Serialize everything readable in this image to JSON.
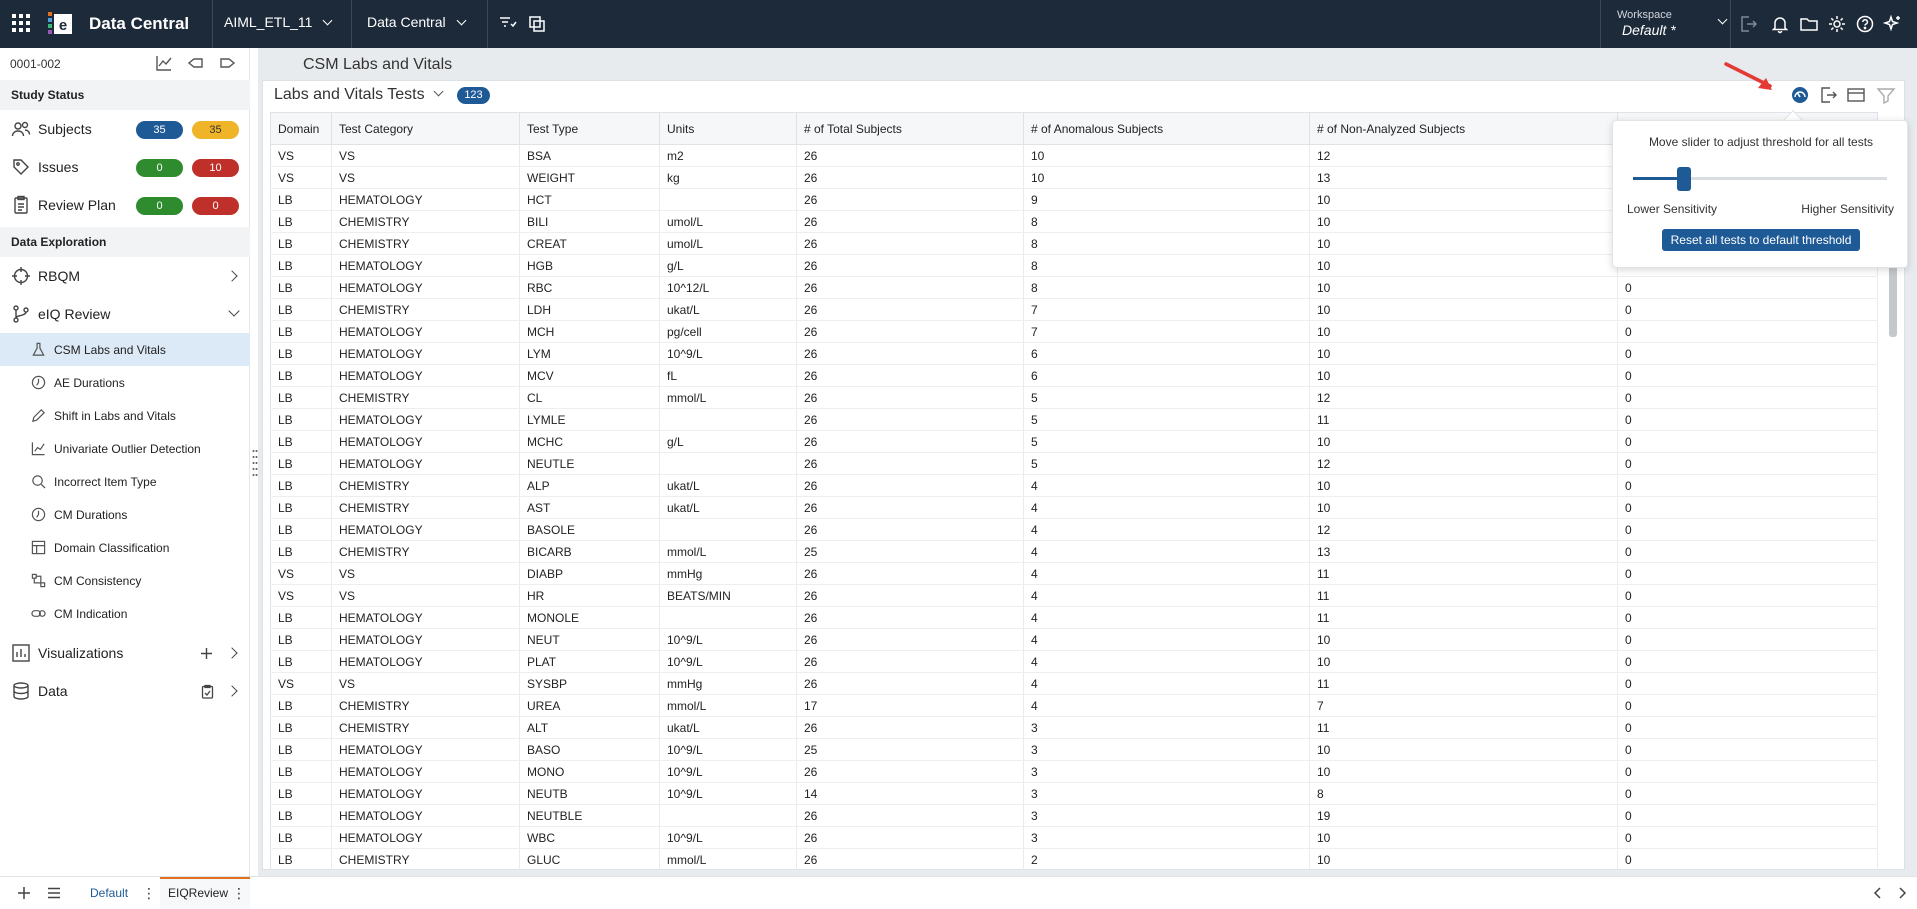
{
  "topbar": {
    "app_name": "Data Central",
    "project_dropdown": "AIML_ETL_11",
    "module_dropdown": "Data Central",
    "workspace_label": "Workspace",
    "workspace_value": "Default",
    "workspace_marker": "*"
  },
  "sidebar": {
    "study_id": "0001-002",
    "study_status_header": "Study Status",
    "status_items": [
      {
        "label": "Subjects",
        "blue": "35",
        "orange": "35"
      },
      {
        "label": "Issues",
        "green": "0",
        "red": "10"
      },
      {
        "label": "Review Plan",
        "green": "0",
        "red": "0"
      }
    ],
    "data_exploration_header": "Data Exploration",
    "rbqm_label": "RBQM",
    "eiq_label": "eIQ Review",
    "sub_items": [
      "CSM Labs and Vitals",
      "AE Durations",
      "Shift in Labs and Vitals",
      "Univariate Outlier Detection",
      "Incorrect Item Type",
      "CM Durations",
      "Domain Classification",
      "CM Consistency",
      "CM Indication"
    ],
    "visualizations_label": "Visualizations",
    "data_label": "Data"
  },
  "main": {
    "page_title": "CSM Labs and Vitals",
    "card_title": "Labs and Vitals Tests",
    "count": "123"
  },
  "table": {
    "columns": [
      "Domain",
      "Test Category",
      "Test Type",
      "Units",
      "# of Total Subjects",
      "# of Anomalous Subjects",
      "# of Non-Analyzed Subjects",
      ""
    ],
    "rows": [
      [
        "VS",
        "VS",
        "BSA",
        "m2",
        "26",
        "10",
        "12",
        ""
      ],
      [
        "VS",
        "VS",
        "WEIGHT",
        "kg",
        "26",
        "10",
        "13",
        ""
      ],
      [
        "LB",
        "HEMATOLOGY",
        "HCT",
        "",
        "26",
        "9",
        "10",
        ""
      ],
      [
        "LB",
        "CHEMISTRY",
        "BILI",
        "umol/L",
        "26",
        "8",
        "10",
        ""
      ],
      [
        "LB",
        "CHEMISTRY",
        "CREAT",
        "umol/L",
        "26",
        "8",
        "10",
        ""
      ],
      [
        "LB",
        "HEMATOLOGY",
        "HGB",
        "g/L",
        "26",
        "8",
        "10",
        ""
      ],
      [
        "LB",
        "HEMATOLOGY",
        "RBC",
        "10^12/L",
        "26",
        "8",
        "10",
        "0"
      ],
      [
        "LB",
        "CHEMISTRY",
        "LDH",
        "ukat/L",
        "26",
        "7",
        "10",
        "0"
      ],
      [
        "LB",
        "HEMATOLOGY",
        "MCH",
        "pg/cell",
        "26",
        "7",
        "10",
        "0"
      ],
      [
        "LB",
        "HEMATOLOGY",
        "LYM",
        "10^9/L",
        "26",
        "6",
        "10",
        "0"
      ],
      [
        "LB",
        "HEMATOLOGY",
        "MCV",
        "fL",
        "26",
        "6",
        "10",
        "0"
      ],
      [
        "LB",
        "CHEMISTRY",
        "CL",
        "mmol/L",
        "26",
        "5",
        "12",
        "0"
      ],
      [
        "LB",
        "HEMATOLOGY",
        "LYMLE",
        "",
        "26",
        "5",
        "11",
        "0"
      ],
      [
        "LB",
        "HEMATOLOGY",
        "MCHC",
        "g/L",
        "26",
        "5",
        "10",
        "0"
      ],
      [
        "LB",
        "HEMATOLOGY",
        "NEUTLE",
        "",
        "26",
        "5",
        "12",
        "0"
      ],
      [
        "LB",
        "CHEMISTRY",
        "ALP",
        "ukat/L",
        "26",
        "4",
        "10",
        "0"
      ],
      [
        "LB",
        "CHEMISTRY",
        "AST",
        "ukat/L",
        "26",
        "4",
        "10",
        "0"
      ],
      [
        "LB",
        "HEMATOLOGY",
        "BASOLE",
        "",
        "26",
        "4",
        "12",
        "0"
      ],
      [
        "LB",
        "CHEMISTRY",
        "BICARB",
        "mmol/L",
        "25",
        "4",
        "13",
        "0"
      ],
      [
        "VS",
        "VS",
        "DIABP",
        "mmHg",
        "26",
        "4",
        "11",
        "0"
      ],
      [
        "VS",
        "VS",
        "HR",
        "BEATS/MIN",
        "26",
        "4",
        "11",
        "0"
      ],
      [
        "LB",
        "HEMATOLOGY",
        "MONOLE",
        "",
        "26",
        "4",
        "11",
        "0"
      ],
      [
        "LB",
        "HEMATOLOGY",
        "NEUT",
        "10^9/L",
        "26",
        "4",
        "10",
        "0"
      ],
      [
        "LB",
        "HEMATOLOGY",
        "PLAT",
        "10^9/L",
        "26",
        "4",
        "10",
        "0"
      ],
      [
        "VS",
        "VS",
        "SYSBP",
        "mmHg",
        "26",
        "4",
        "11",
        "0"
      ],
      [
        "LB",
        "CHEMISTRY",
        "UREA",
        "mmol/L",
        "17",
        "4",
        "7",
        "0"
      ],
      [
        "LB",
        "CHEMISTRY",
        "ALT",
        "ukat/L",
        "26",
        "3",
        "11",
        "0"
      ],
      [
        "LB",
        "HEMATOLOGY",
        "BASO",
        "10^9/L",
        "25",
        "3",
        "10",
        "0"
      ],
      [
        "LB",
        "HEMATOLOGY",
        "MONO",
        "10^9/L",
        "26",
        "3",
        "10",
        "0"
      ],
      [
        "LB",
        "HEMATOLOGY",
        "NEUTB",
        "10^9/L",
        "14",
        "3",
        "8",
        "0"
      ],
      [
        "LB",
        "HEMATOLOGY",
        "NEUTBLE",
        "",
        "26",
        "3",
        "19",
        "0"
      ],
      [
        "LB",
        "HEMATOLOGY",
        "WBC",
        "10^9/L",
        "26",
        "3",
        "10",
        "0"
      ],
      [
        "LB",
        "CHEMISTRY",
        "GLUC",
        "mmol/L",
        "26",
        "2",
        "10",
        "0"
      ]
    ]
  },
  "popup": {
    "message": "Move slider to adjust threshold for all tests",
    "slider_value": 0.2,
    "low_label": "Lower Sensitivity",
    "high_label": "Higher Sensitivity",
    "reset_button": "Reset all tests to default threshold"
  },
  "bottom": {
    "tabs": [
      "Default",
      "EIQReview"
    ],
    "active_tab": "EIQReview"
  },
  "colors": {
    "topbar": "#1d2a3a",
    "accent_blue": "#1e5a96",
    "badge_orange": "#f0b429",
    "badge_green": "#2e8b2e",
    "badge_red": "#c0302b",
    "active_tab_border": "#e07020"
  }
}
